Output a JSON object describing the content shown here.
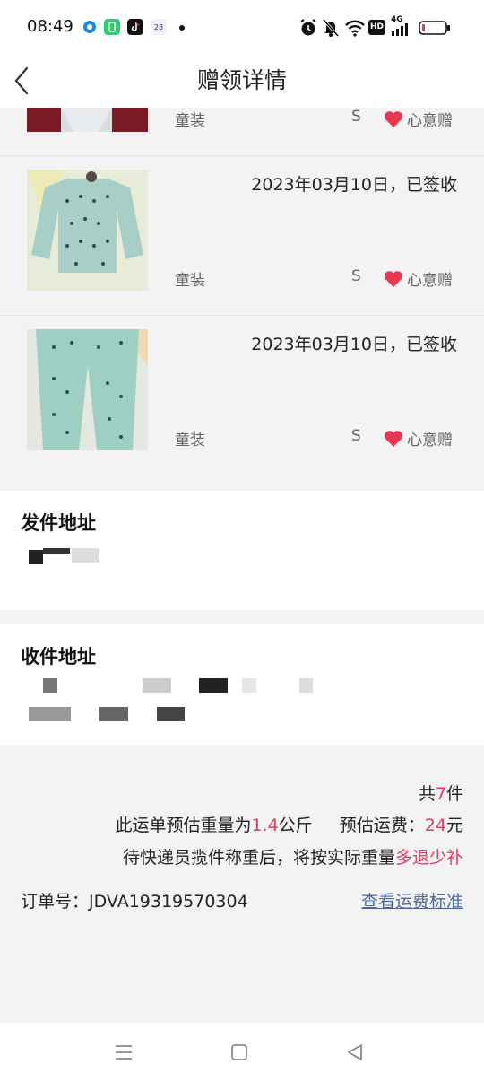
{
  "status_bar": {
    "time": "08:49",
    "icons": [
      "notification-dot-icon",
      "alarm-icon",
      "mute-icon",
      "wifi-icon",
      "hd-icon",
      "signal-4g-icon",
      "battery-icon"
    ],
    "calendar_badge": "28",
    "signal_label": "4G",
    "hd_label": "HD"
  },
  "header": {
    "title": "赠领详情",
    "back_icon": "chevron-left-icon"
  },
  "items": [
    {
      "date": "",
      "category": "童装",
      "size": "S",
      "gift_label": "心意赠"
    },
    {
      "date": "2023年03月10日，已签收",
      "category": "童装",
      "size": "S",
      "gift_label": "心意赠"
    },
    {
      "date": "2023年03月10日，已签收",
      "category": "童装",
      "size": "S",
      "gift_label": "心意赠"
    }
  ],
  "sender": {
    "title": "发件地址"
  },
  "receiver": {
    "title": "收件地址"
  },
  "summary": {
    "count_prefix": "共",
    "count": "7",
    "count_suffix": "件",
    "weight_prefix": "此运单预估重量为",
    "weight": "1.4",
    "weight_unit": "公斤",
    "fee_prefix": "预估运费：",
    "fee": "24",
    "fee_unit": "元",
    "note_prefix": "待快递员揽件称重后，将按实际重量",
    "note_highlight": "多退少补",
    "order_label": "订单号：",
    "order_number": "JDVA19319570304",
    "fee_link": "查看运费标准"
  },
  "colors": {
    "accent": "#e03a5f",
    "link": "#4a67a1",
    "heart": "#e8374f",
    "background": "#f3f3f3"
  },
  "nav": {
    "icons": [
      "menu-icon",
      "home-square-icon",
      "back-triangle-icon"
    ]
  }
}
